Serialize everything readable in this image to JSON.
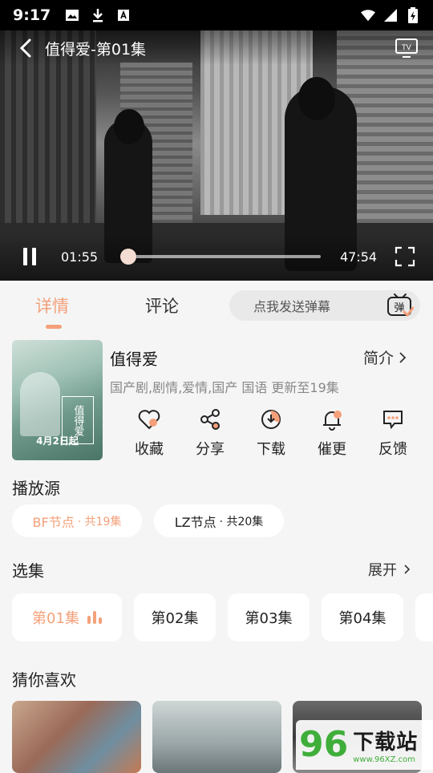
{
  "status_bar": {
    "time": "9:17"
  },
  "player": {
    "title": "值得爱-第01集",
    "current_time": "01:55",
    "total_time": "47:54",
    "progress_fraction": 0.04
  },
  "tabs": [
    {
      "label": "详情",
      "active": true
    },
    {
      "label": "评论",
      "active": false
    }
  ],
  "danmu_input": {
    "placeholder": "点我发送弹幕",
    "icon_char": "弹"
  },
  "show": {
    "poster_title": "值得爱",
    "poster_date": "4月2日起",
    "title": "值得爱",
    "intro_label": "简介",
    "meta": "国产剧,剧情,爱情,国产 国语 更新至19集"
  },
  "actions": [
    {
      "label": "收藏",
      "icon": "heart-icon"
    },
    {
      "label": "分享",
      "icon": "share-icon"
    },
    {
      "label": "下载",
      "icon": "download-icon"
    },
    {
      "label": "催更",
      "icon": "bell-icon"
    },
    {
      "label": "反馈",
      "icon": "feedback-icon"
    }
  ],
  "sources": {
    "title": "播放源",
    "items": [
      {
        "name": "BF节点",
        "count": "· 共19集",
        "active": true
      },
      {
        "name": "LZ节点",
        "count": "· 共20集",
        "active": false
      }
    ]
  },
  "episodes": {
    "title": "选集",
    "expand_label": "展开",
    "items": [
      "第01集",
      "第02集",
      "第03集",
      "第04集"
    ]
  },
  "recommend": {
    "title": "猜你喜欢"
  },
  "watermark": {
    "logo": "96",
    "text": "下载站",
    "url": "www.96XZ.com"
  },
  "colors": {
    "accent": "#f4a07a",
    "background": "#f5f5f5"
  }
}
